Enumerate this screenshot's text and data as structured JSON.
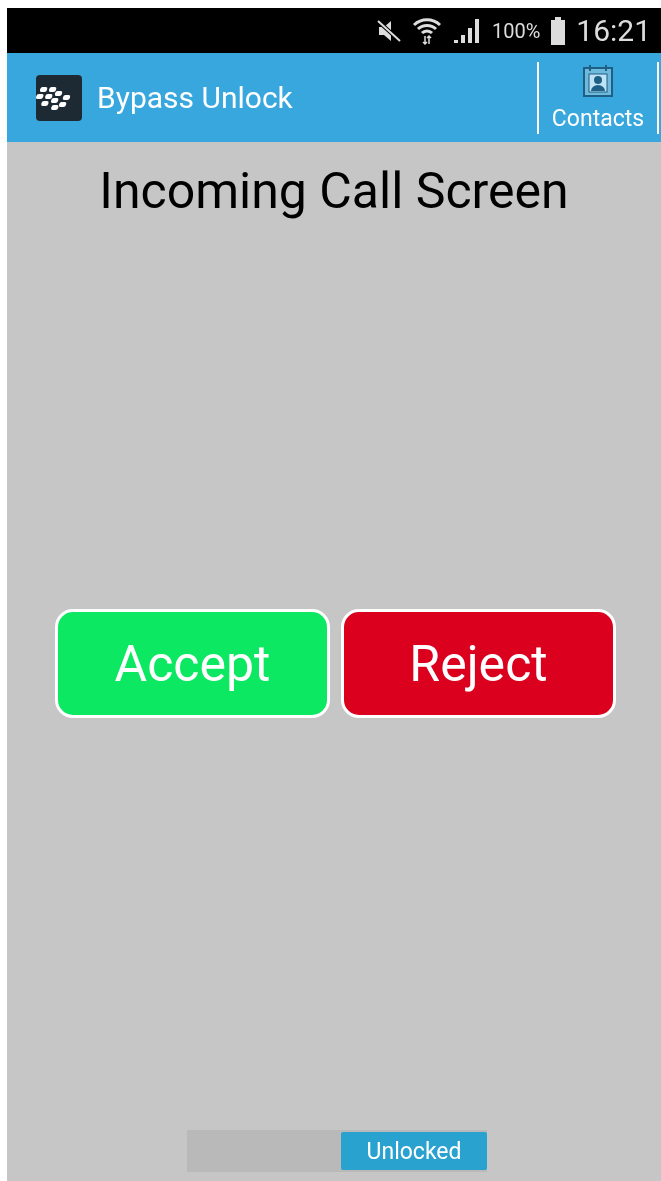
{
  "status_bar": {
    "battery": "100%",
    "time": "16:21"
  },
  "app_bar": {
    "title": "Bypass Unlock",
    "action": "Contacts"
  },
  "heading": "Incoming Call Screen",
  "buttons": [
    {
      "kind": "accept",
      "label": "Accept"
    },
    {
      "kind": "reject",
      "label": "Reject"
    }
  ],
  "lock_switch": {
    "label": "Unlocked",
    "on": true
  }
}
